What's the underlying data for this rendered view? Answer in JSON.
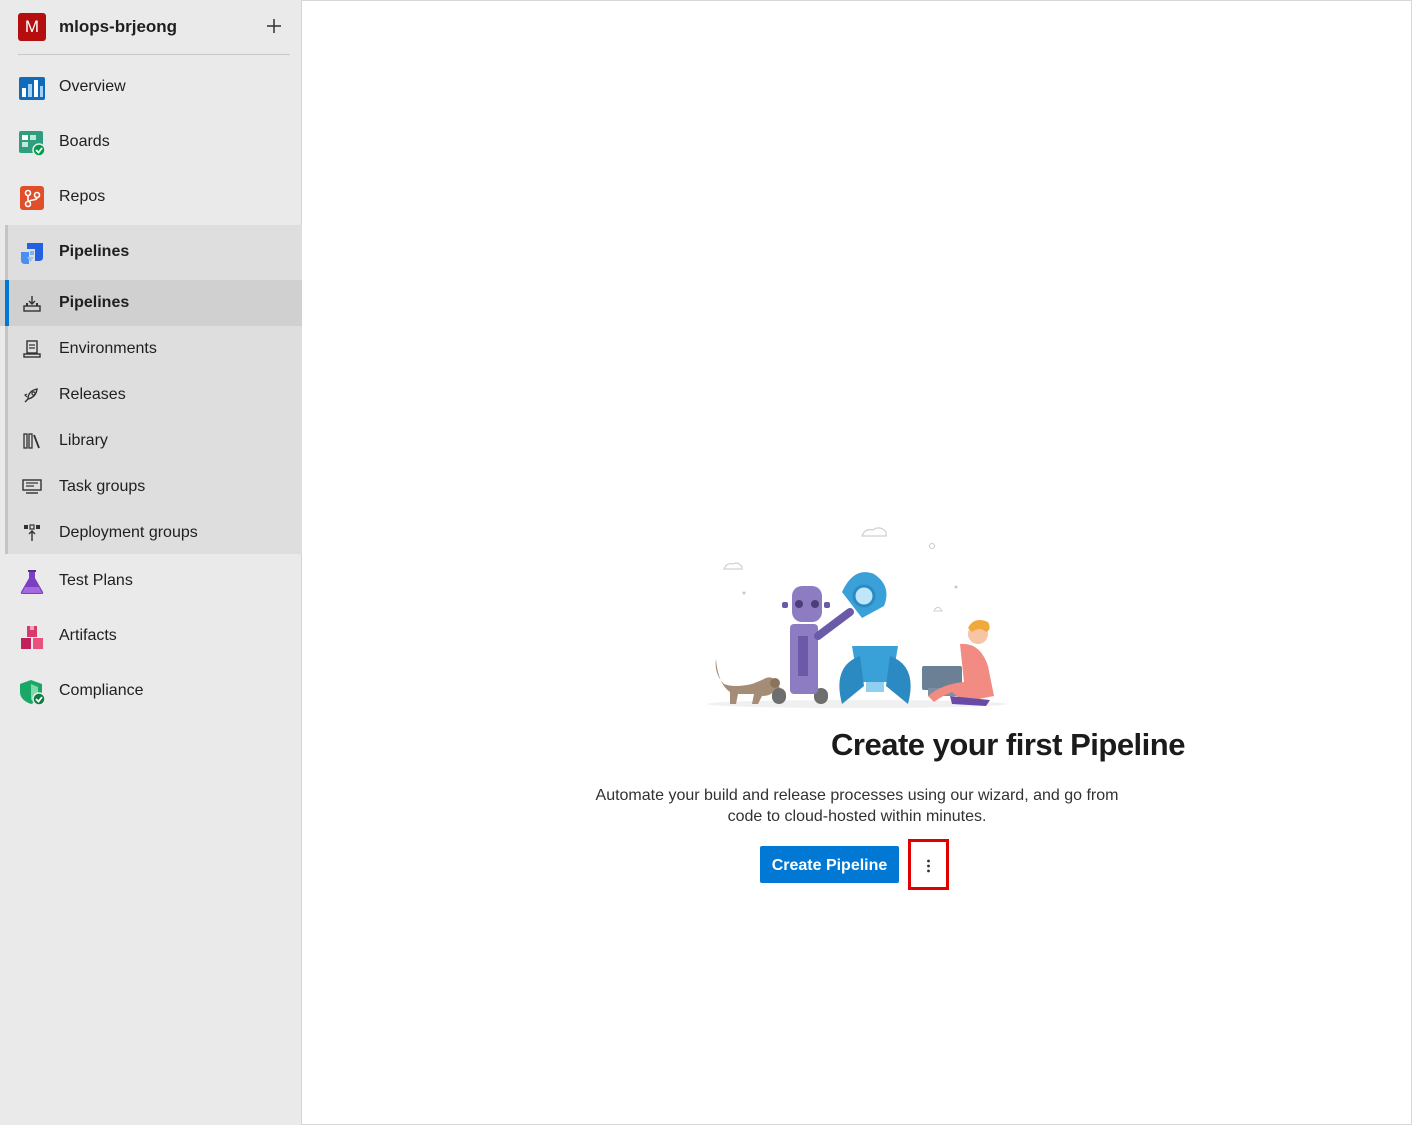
{
  "project": {
    "initial": "M",
    "name": "mlops-brjeong",
    "avatar_color": "#b40e0e"
  },
  "nav": {
    "overview": "Overview",
    "boards": "Boards",
    "repos": "Repos",
    "pipelines": "Pipelines",
    "test_plans": "Test Plans",
    "artifacts": "Artifacts",
    "compliance": "Compliance"
  },
  "pipelines_sub": {
    "pipelines": "Pipelines",
    "environments": "Environments",
    "releases": "Releases",
    "library": "Library",
    "task_groups": "Task groups",
    "deployment_groups": "Deployment groups"
  },
  "empty_state": {
    "title": "Create your first Pipeline",
    "description": "Automate your build and release processes using our wizard, and go from code to cloud-hosted within minutes.",
    "create_button": "Create Pipeline"
  },
  "colors": {
    "accent": "#0078d4",
    "highlight": "#e00000"
  }
}
